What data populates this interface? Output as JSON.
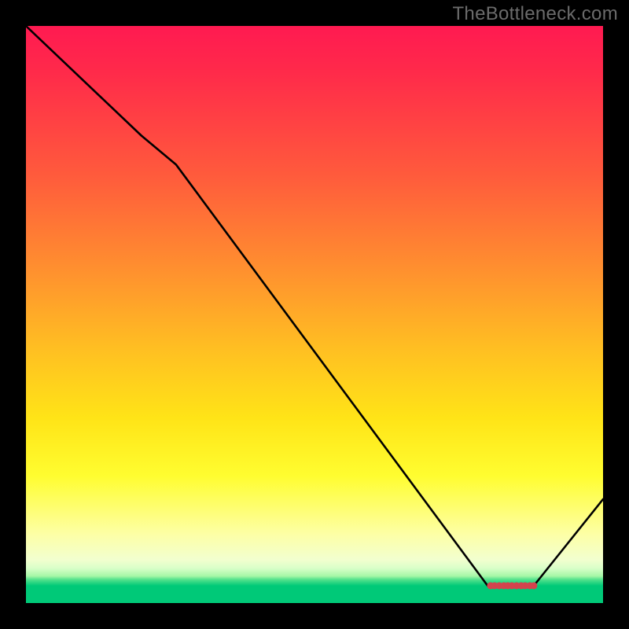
{
  "watermark": "TheBottleneck.com",
  "chart_data": {
    "type": "line",
    "title": "",
    "xlabel": "",
    "ylabel": "",
    "xlim": [
      0,
      100
    ],
    "ylim": [
      0,
      100
    ],
    "series": [
      {
        "name": "curve",
        "x": [
          0,
          20,
          26,
          80,
          82,
          88,
          100
        ],
        "values": [
          100,
          81,
          76,
          3,
          3,
          3,
          18
        ]
      }
    ],
    "flat_segment": {
      "x_start": 80,
      "x_end": 88,
      "y": 3
    },
    "markers": {
      "y": 3,
      "x": [
        80.5,
        81.2,
        82.0,
        82.8,
        83.5,
        84.2,
        85.0,
        85.8,
        86.5,
        87.3,
        88.0
      ],
      "color": "#d4434d",
      "radius_px": 4.5
    },
    "gradient_stops": [
      {
        "pos": 0.0,
        "color": "#ff1a51"
      },
      {
        "pos": 0.26,
        "color": "#ff5b3c"
      },
      {
        "pos": 0.56,
        "color": "#ffbf22"
      },
      {
        "pos": 0.78,
        "color": "#fffd30"
      },
      {
        "pos": 0.93,
        "color": "#f2ffcf"
      },
      {
        "pos": 0.97,
        "color": "#00c978"
      }
    ]
  }
}
